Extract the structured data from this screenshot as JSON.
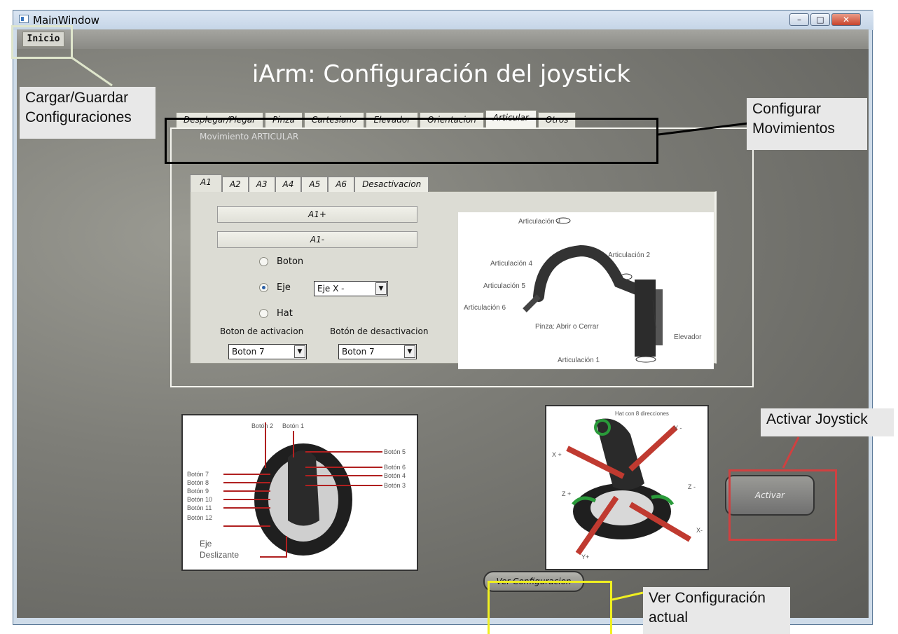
{
  "window": {
    "title": "MainWindow",
    "min_label": "–",
    "max_label": "□",
    "close_label": "✕"
  },
  "menu": {
    "inicio": "Inicio"
  },
  "app_title": "iArm: Configuración del joystick",
  "main_tabs": [
    {
      "label": "Desplegar/Plegar",
      "active": false
    },
    {
      "label": "Pinza",
      "active": false
    },
    {
      "label": "Cartesiano",
      "active": false
    },
    {
      "label": "Elevador",
      "active": false
    },
    {
      "label": "Orientacion",
      "active": false
    },
    {
      "label": "Articular",
      "active": true
    },
    {
      "label": "Otros",
      "active": false
    }
  ],
  "panel_legend": "Movimiento ARTICULAR",
  "sub_tabs": [
    {
      "label": "A1",
      "active": true
    },
    {
      "label": "A2",
      "active": false
    },
    {
      "label": "A3",
      "active": false
    },
    {
      "label": "A4",
      "active": false
    },
    {
      "label": "A5",
      "active": false
    },
    {
      "label": "A6",
      "active": false
    },
    {
      "label": "Desactivacion",
      "active": false
    }
  ],
  "sub_panel": {
    "btn_plus": "A1+",
    "btn_minus": "A1-",
    "radio_boton": "Boton",
    "radio_eje": "Eje",
    "radio_hat": "Hat",
    "radio_selected": "Eje",
    "eje_value": "Eje X -",
    "activacion_label": "Boton de activacion",
    "desactivacion_label": "Botón de desactivacion",
    "activacion_value": "Boton 7",
    "desactivacion_value": "Boton 7"
  },
  "arm_image": {
    "labels": {
      "art3": "Articulación 3",
      "art2": "Articulación 2",
      "art4": "Articulación 4",
      "art5": "Articulación 5",
      "art6": "Articulación 6",
      "pinza": "Pinza: Abrir o Cerrar",
      "elevador": "Elevador",
      "art1": "Articulación 1"
    }
  },
  "joystick_buttons_image": {
    "labels": {
      "b2": "Botón 2",
      "b1": "Botón 1",
      "b5": "Botón 5",
      "b6": "Botón 6",
      "b4": "Botón 4",
      "b3": "Botón 3",
      "b7": "Botón 7",
      "b8": "Botón 8",
      "b9": "Botón 9",
      "b10": "Botón 10",
      "b11": "Botón 11",
      "b12": "Botón 12",
      "eje": "Eje",
      "deslizante": "Deslizante"
    }
  },
  "joystick_axes_image": {
    "labels": {
      "hat": "Hat con 8 direcciones",
      "yminus": "Y -",
      "xplus": "X +",
      "zplus": "Z +",
      "zminus": "Z -",
      "xminus": "X-",
      "yplus": "Y+"
    }
  },
  "buttons": {
    "activar": "Activar",
    "ver_config": "Ver Configuracion"
  },
  "callouts": {
    "cargar": "Cargar/Guardar Configuraciones",
    "configurar": "Configurar Movimientos",
    "activar_joystick": "Activar Joystick",
    "ver_actual": "Ver Configuración actual"
  },
  "colors": {
    "callout_inicio": "#dfe6cc",
    "callout_tabs": "#000000",
    "callout_activar": "#d04040",
    "callout_ver": "#f0f020"
  }
}
